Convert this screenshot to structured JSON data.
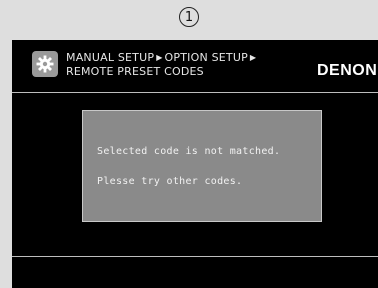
{
  "step_marker": {
    "label": "1"
  },
  "header": {
    "icon": "gear-icon",
    "breadcrumb": {
      "line1": {
        "part1": "MANUAL SETUP",
        "part2": "OPTION SETUP"
      },
      "line2": "REMOTE PRESET CODES"
    },
    "brand": "DENON"
  },
  "dialog": {
    "line1": "Selected code is not matched.",
    "line2": "Plesse try other codes."
  }
}
